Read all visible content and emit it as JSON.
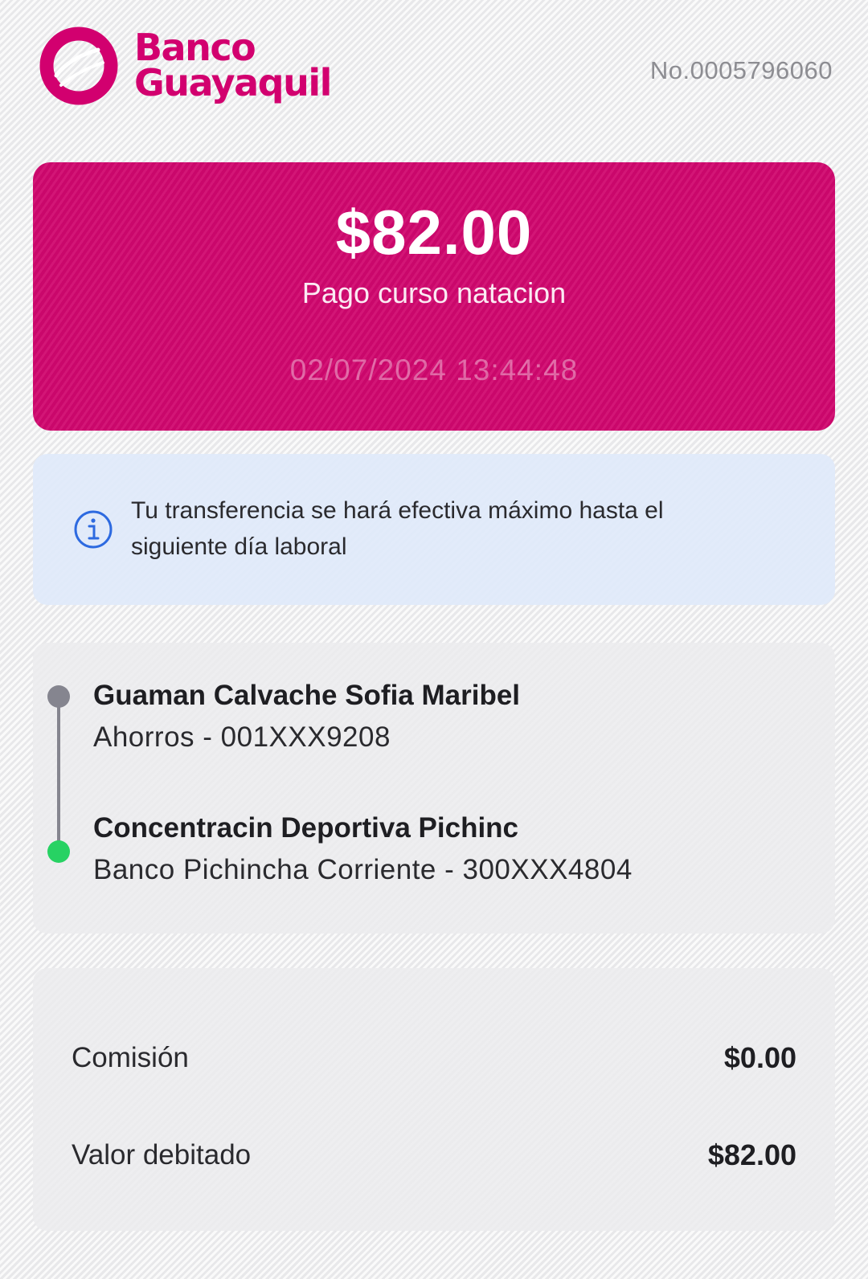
{
  "header": {
    "brand_line1": "Banco",
    "brand_line2": "Guayaquil",
    "reference_number": "No.0005796060",
    "logo_icon": "banco-guayaquil-ring-logo"
  },
  "transfer": {
    "amount": "$82.00",
    "concept": "Pago curso natacion",
    "datetime": "02/07/2024 13:44:48"
  },
  "notice": {
    "icon": "info-icon",
    "text": "Tu transferencia se hará efectiva máximo hasta el siguiente día laboral"
  },
  "origin": {
    "name": "Guaman Calvache Sofia Maribel",
    "account": "Ahorros - 001XXX9208"
  },
  "destination": {
    "name": "Concentracin Deportiva Pichinc",
    "account": "Banco Pichincha Corriente - 300XXX4804"
  },
  "summary": {
    "commission_label": "Comisión",
    "commission_value": "$0.00",
    "debited_label": "Valor debitado",
    "debited_value": "$82.00"
  },
  "colors": {
    "brand": "#d2006f",
    "card": "#d0076e",
    "info_accent": "#2d6ae0",
    "origin_dot": "#85858f",
    "destination_dot": "#27d263"
  }
}
